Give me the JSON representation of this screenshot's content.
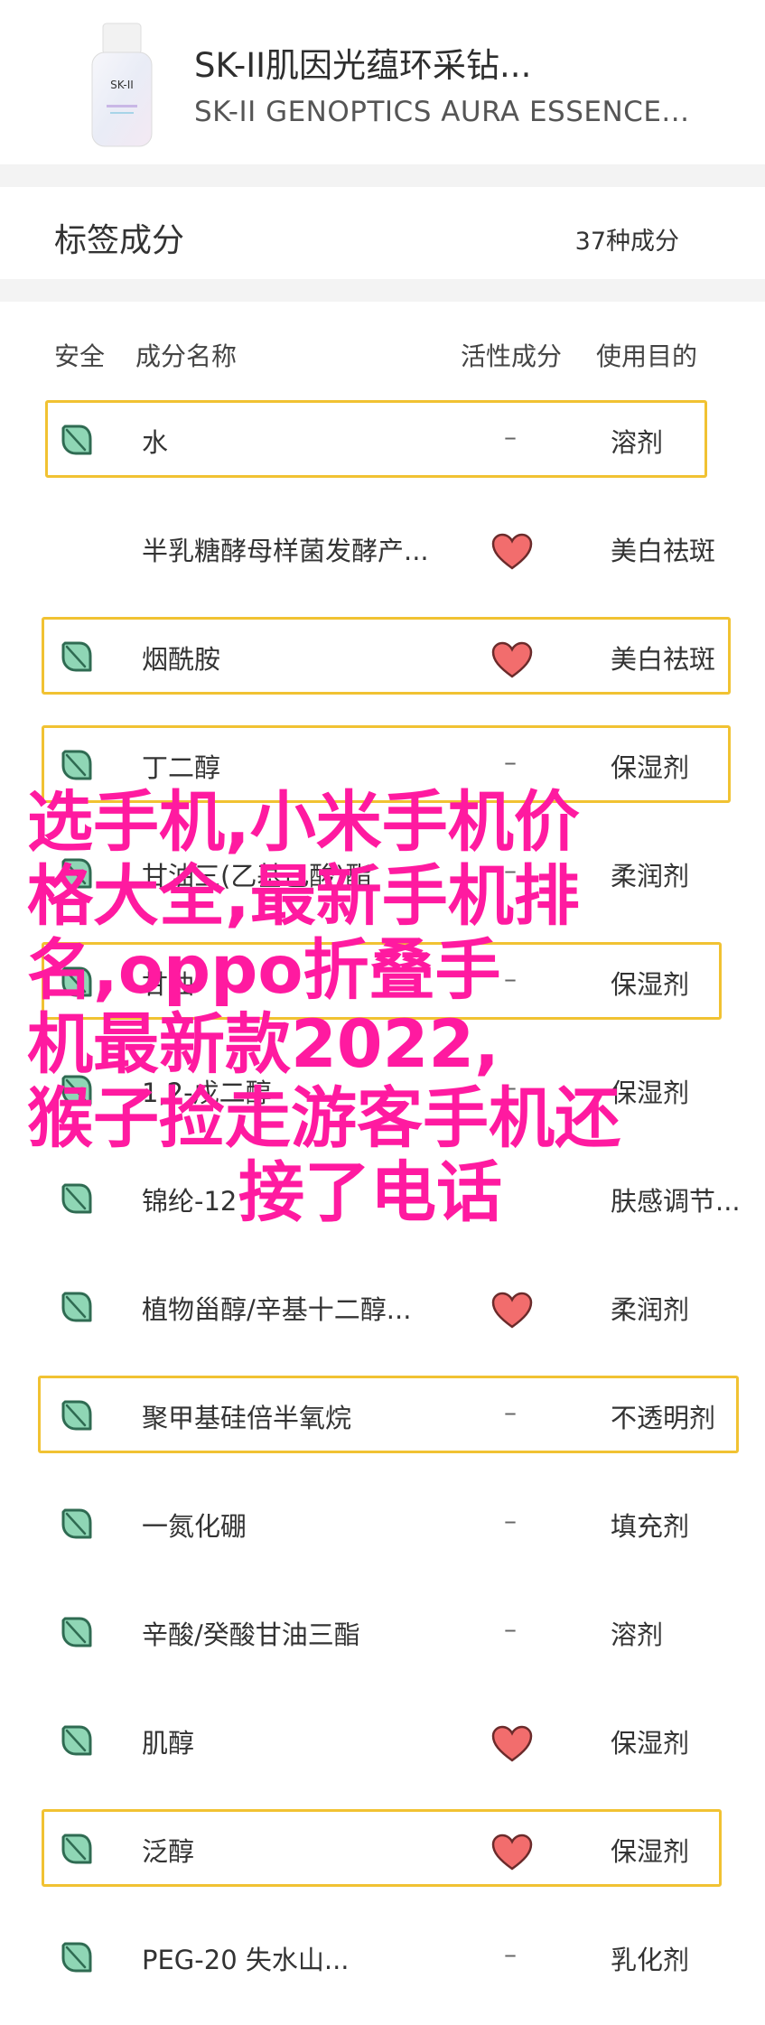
{
  "product": {
    "name_cn": "SK-II肌因光蕴环采钻...",
    "name_en": "SK-II GENOPTICS AURA ESSENCE...",
    "bottle_label": "SK-II"
  },
  "section": {
    "title": "标签成分",
    "count": "37种成分"
  },
  "columns": {
    "safety": "安全",
    "name": "成分名称",
    "active": "活性成分",
    "purpose": "使用目的"
  },
  "rows": [
    {
      "name": "水",
      "active": "–",
      "purpose": "溶剂"
    },
    {
      "name": "半乳糖酵母样菌发酵产...",
      "active": "heart",
      "purpose": "美白祛斑"
    },
    {
      "name": "烟酰胺",
      "active": "heart",
      "purpose": "美白祛斑"
    },
    {
      "name": "丁二醇",
      "active": "–",
      "purpose": "保湿剂"
    },
    {
      "name": "甘油三(乙基己酸)酯",
      "active": "–",
      "purpose": "柔润剂"
    },
    {
      "name": "甘油",
      "active": "–",
      "purpose": "保湿剂"
    },
    {
      "name": "1,2-戊二醇",
      "active": "–",
      "purpose": "保湿剂"
    },
    {
      "name": "锦纶-12",
      "active": "",
      "purpose": "肤感调节..."
    },
    {
      "name": "植物甾醇/辛基十二醇...",
      "active": "heart",
      "purpose": "柔润剂"
    },
    {
      "name": "聚甲基硅倍半氧烷",
      "active": "–",
      "purpose": "不透明剂"
    },
    {
      "name": "一氮化硼",
      "active": "–",
      "purpose": "填充剂"
    },
    {
      "name": "辛酸/癸酸甘油三酯",
      "active": "–",
      "purpose": "溶剂"
    },
    {
      "name": "肌醇",
      "active": "heart",
      "purpose": "保湿剂"
    },
    {
      "name": "泛醇",
      "active": "heart",
      "purpose": "保湿剂"
    },
    {
      "name": "PEG-20 失水山...",
      "active": "–",
      "purpose": "乳化剂"
    }
  ],
  "overlay_text": {
    "line1": "选手机,小米手机价",
    "line2": "格大全,最新手机排",
    "line3": "名,oppo折叠手",
    "line4": "机最新款2022,",
    "line5": "猴子捡走游客手机还",
    "line6": "接了电话"
  },
  "colors": {
    "highlight": "#f1c232",
    "heart": "#f26d6d",
    "leaf": "#8fd6b5",
    "overlay": "#ff1aa0"
  }
}
